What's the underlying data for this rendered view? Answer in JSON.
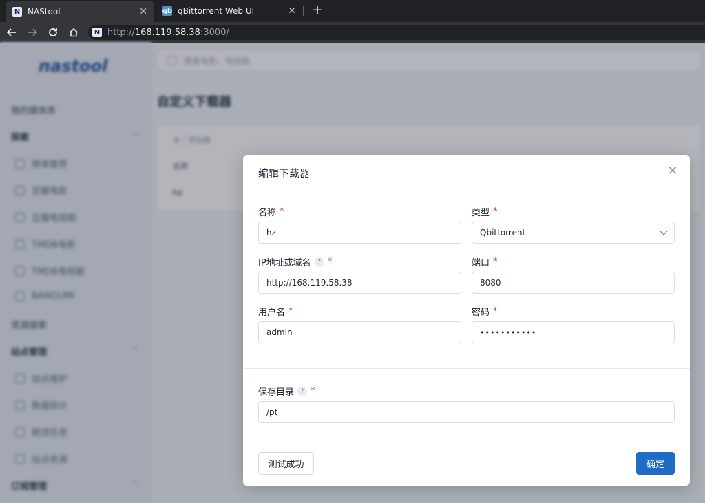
{
  "browser": {
    "tabs": [
      {
        "title": "NAStool",
        "favicon": "N",
        "close": "✕"
      },
      {
        "title": "qBittorrent Web UI",
        "favicon": "qb",
        "close": "✕"
      }
    ],
    "new_tab": "+",
    "url_scheme": "http://",
    "url_host": "168.119.58.38",
    "url_rest": ":3000/"
  },
  "app": {
    "logo": "nastool",
    "sidebar": [
      {
        "label": "我的媒体库",
        "type": "item"
      },
      {
        "label": "探索",
        "type": "group"
      },
      {
        "label": "榜单推荐",
        "type": "sub"
      },
      {
        "label": "豆瓣电影",
        "type": "sub"
      },
      {
        "label": "豆瓣电视剧",
        "type": "sub"
      },
      {
        "label": "TMDB电影",
        "type": "sub"
      },
      {
        "label": "TMDB电视剧",
        "type": "sub"
      },
      {
        "label": "BANGUMI",
        "type": "sub"
      },
      {
        "label": "资源搜索",
        "type": "item"
      },
      {
        "label": "站点管理",
        "type": "group"
      },
      {
        "label": "站点维护",
        "type": "sub"
      },
      {
        "label": "数据统计",
        "type": "sub"
      },
      {
        "label": "刷流任务",
        "type": "sub"
      },
      {
        "label": "站点资源",
        "type": "sub"
      },
      {
        "label": "订阅管理",
        "type": "group"
      }
    ],
    "search_placeholder": "搜索电影、电视剧",
    "page_title": "自定义下载器",
    "breadcrumb": "全 / 添加器",
    "table_header": "名称",
    "table_row": "hz"
  },
  "modal": {
    "title": "编辑下载器",
    "close": "✕",
    "fields": {
      "name": {
        "label": "名称",
        "value": "hz"
      },
      "type": {
        "label": "类型",
        "value": "Qbittorrent"
      },
      "host": {
        "label": "IP地址或域名",
        "value": "http://168.119.58.38"
      },
      "port": {
        "label": "端口",
        "value": "8080"
      },
      "username": {
        "label": "用户名",
        "value": "admin"
      },
      "password": {
        "label": "密码",
        "value": "•••••••••••"
      },
      "save_dir": {
        "label": "保存目录",
        "value": "/pt"
      }
    },
    "required_mark": "*",
    "help_mark": "?",
    "test_button": "测试成功",
    "confirm_button": "确定"
  },
  "colors": {
    "primary": "#206bc4",
    "required": "#d63939",
    "chrome_dark": "#202124"
  }
}
